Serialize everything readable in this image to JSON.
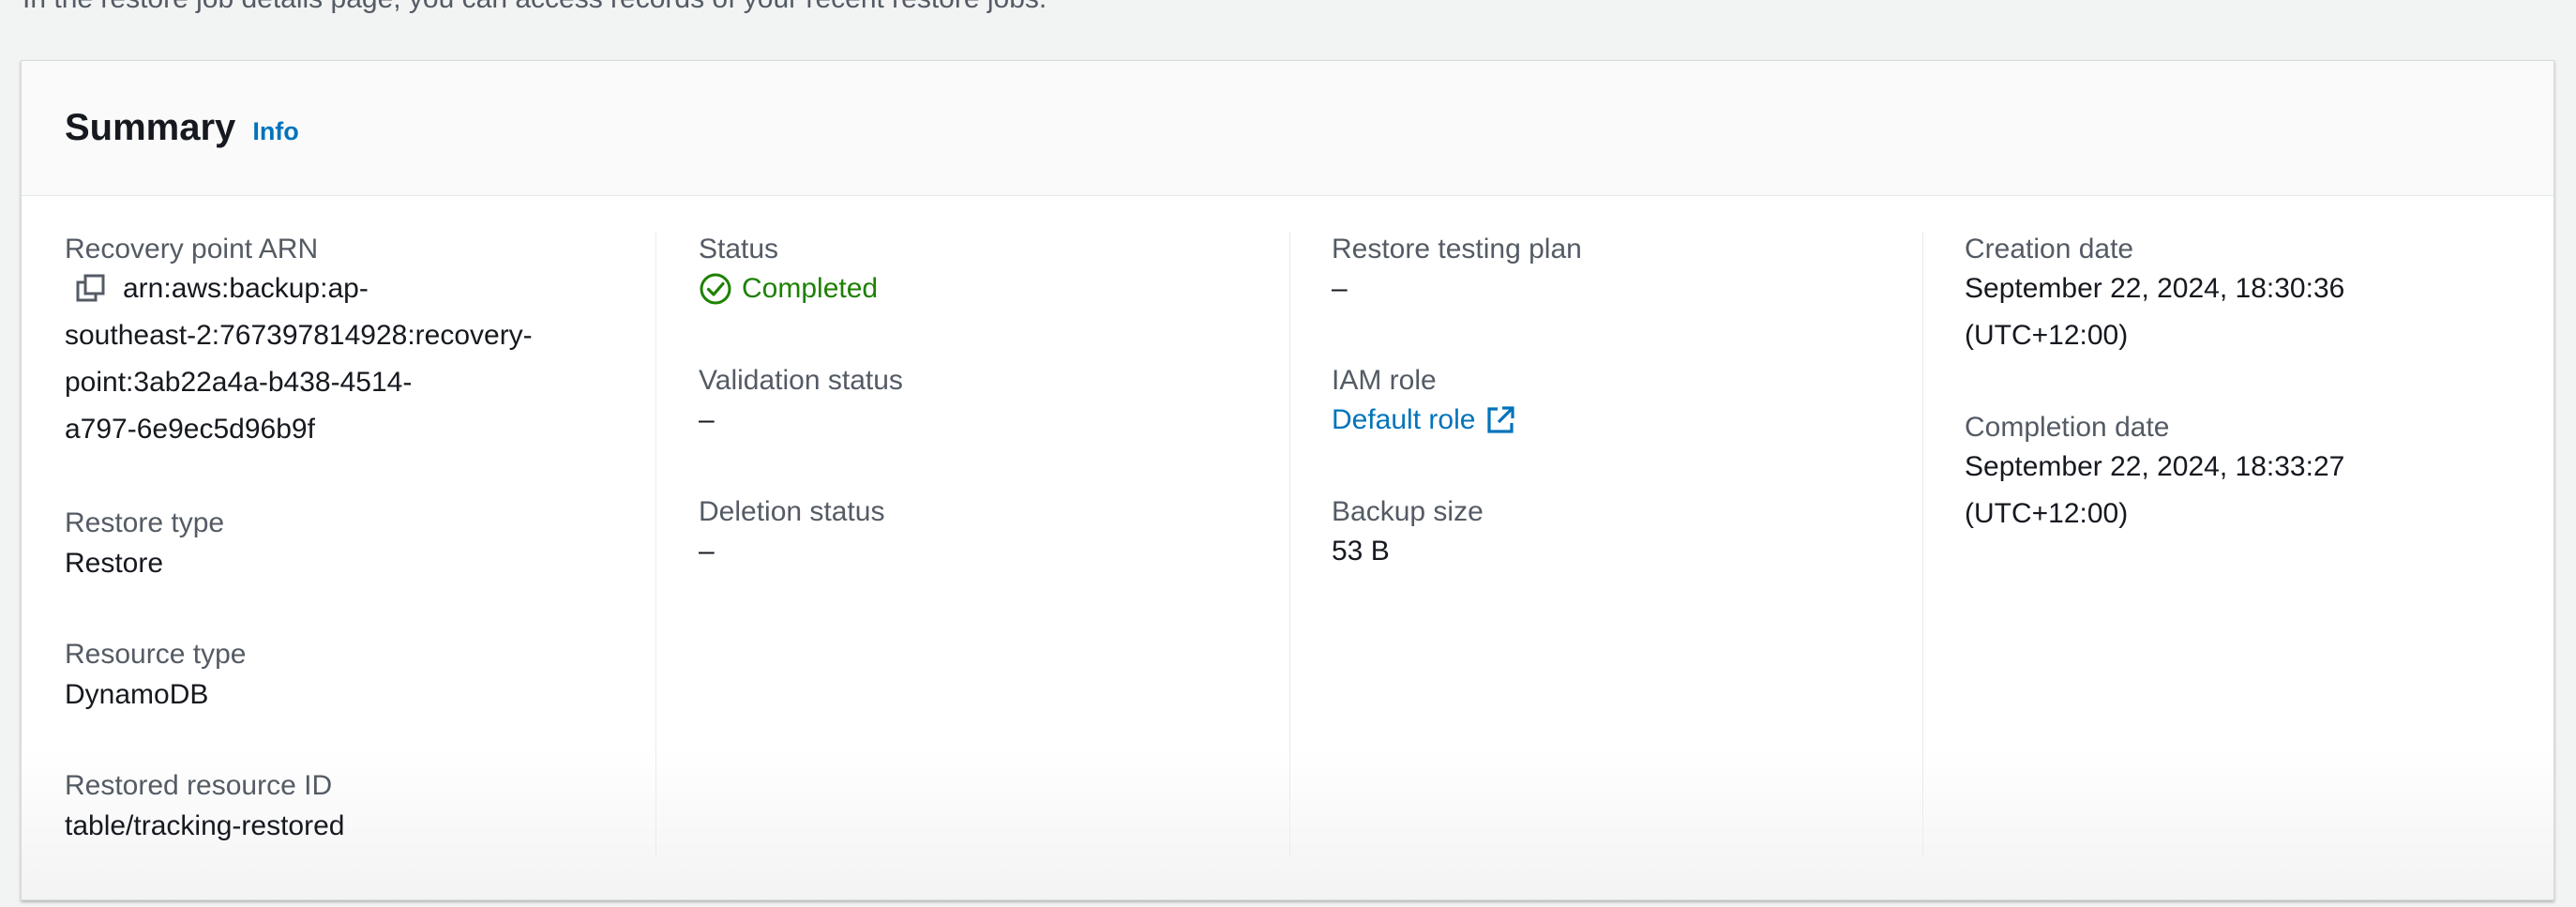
{
  "intro_text": "In the restore job details page, you can access records of your recent restore jobs.",
  "summary": {
    "title": "Summary",
    "info_label": "Info"
  },
  "fields": {
    "recovery_point_arn": {
      "label": "Recovery point ARN",
      "lines": [
        "arn:aws:backup:ap-",
        "southeast-2:767397814928:recovery-",
        "point:3ab22a4a-b438-4514-",
        "a797-6e9ec5d96b9f"
      ]
    },
    "restore_type": {
      "label": "Restore type",
      "value": "Restore"
    },
    "resource_type": {
      "label": "Resource type",
      "value": "DynamoDB"
    },
    "restored_resource_id": {
      "label": "Restored resource ID",
      "value": "table/tracking-restored"
    },
    "status": {
      "label": "Status",
      "value": "Completed"
    },
    "validation_status": {
      "label": "Validation status",
      "value": "–"
    },
    "deletion_status": {
      "label": "Deletion status",
      "value": "–"
    },
    "restore_testing_plan": {
      "label": "Restore testing plan",
      "value": "–"
    },
    "iam_role": {
      "label": "IAM role",
      "value": "Default role"
    },
    "backup_size": {
      "label": "Backup size",
      "value": "53 B"
    },
    "creation_date": {
      "label": "Creation date",
      "lines": [
        "September 22, 2024, 18:30:36",
        "(UTC+12:00)"
      ]
    },
    "completion_date": {
      "label": "Completion date",
      "lines": [
        "September 22, 2024, 18:33:27",
        "(UTC+12:00)"
      ]
    }
  },
  "icons": {
    "copy": "copy-icon",
    "status": "check-circle-icon",
    "external": "external-link-icon"
  },
  "colors": {
    "link": "#0073bb",
    "success": "#1d8102",
    "label": "#545b64",
    "text": "#16191f"
  }
}
